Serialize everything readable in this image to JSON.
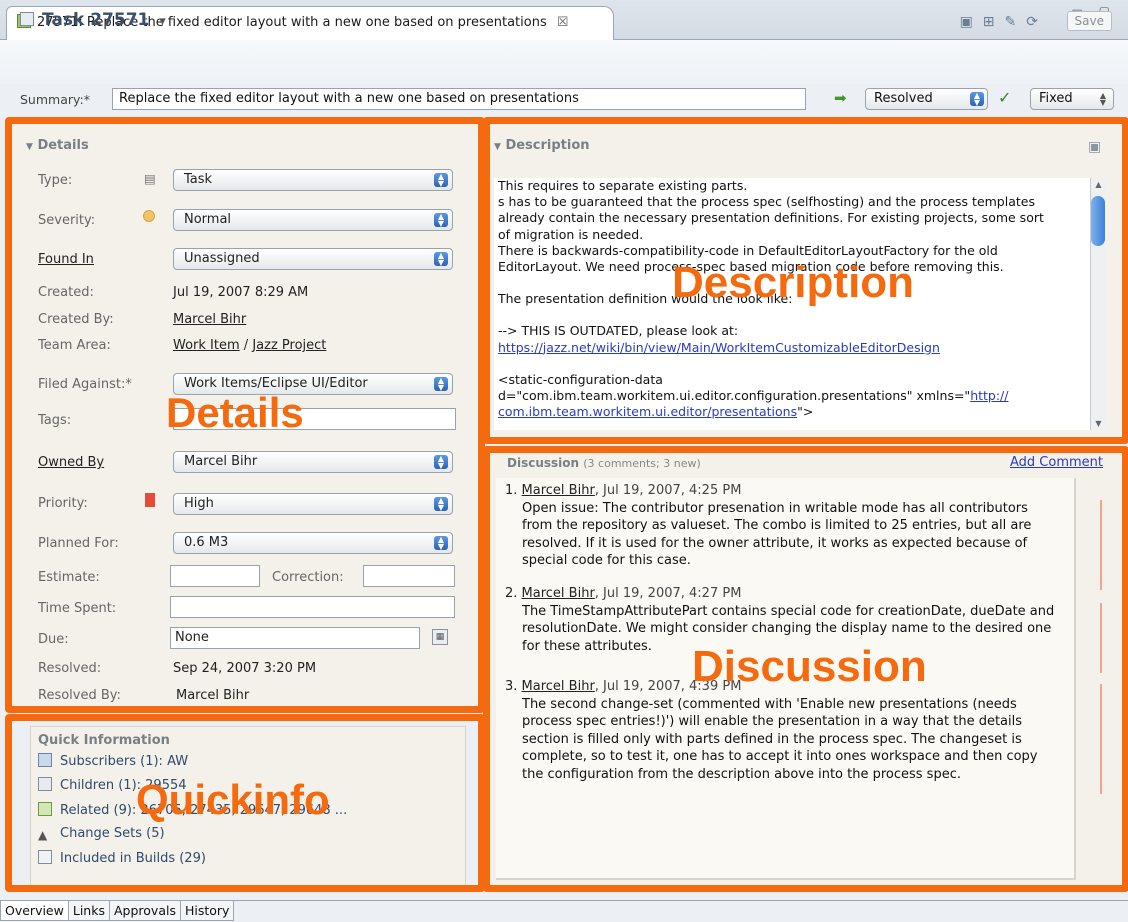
{
  "editor_tab": {
    "title": "27571: Replace the fixed editor layout with a new one based on presentations",
    "close": "☒"
  },
  "window_controls": "▭ ▢",
  "header": {
    "title": "Task 27571",
    "dropdown": "▾",
    "save_label": "Save"
  },
  "summary": {
    "label": "Summary:*",
    "value": "Replace the fixed editor layout with a new one based on presentations",
    "state": "Resolved",
    "resolution": "Fixed"
  },
  "details": {
    "header": "Details",
    "fields": {
      "type": {
        "label": "Type:",
        "value": "Task"
      },
      "severity": {
        "label": "Severity:",
        "value": "Normal"
      },
      "found_in": {
        "label": "Found In",
        "value": "Unassigned"
      },
      "created": {
        "label": "Created:",
        "value": "Jul 19, 2007 8:29 AM"
      },
      "created_by": {
        "label": "Created By:",
        "value": "Marcel Bihr"
      },
      "team_area": {
        "label": "Team Area:",
        "value_a": "Work Item",
        "sep": "/",
        "value_b": "Jazz Project"
      },
      "filed_against": {
        "label": "Filed Against:*",
        "value": "Work Items/Eclipse UI/Editor"
      },
      "tags": {
        "label": "Tags:",
        "value": ""
      },
      "owned_by": {
        "label": "Owned By",
        "value": "Marcel Bihr"
      },
      "priority": {
        "label": "Priority:",
        "value": "High"
      },
      "planned_for": {
        "label": "Planned For:",
        "value": "0.6 M3"
      },
      "estimate": {
        "label": "Estimate:",
        "value": ""
      },
      "correction": {
        "label": "Correction:",
        "value": ""
      },
      "time_spent": {
        "label": "Time Spent:",
        "value": ""
      },
      "due": {
        "label": "Due:",
        "value": "None"
      },
      "resolved": {
        "label": "Resolved:",
        "value": "Sep 24, 2007 3:20 PM"
      },
      "resolved_by": {
        "label": "Resolved By:",
        "value": "Marcel Bihr"
      }
    }
  },
  "description": {
    "header": "Description",
    "lines": [
      "This requires to separate existing parts.",
      "s has to be guaranteed that the process spec (selfhosting) and the process templates",
      "already contain the necessary presentation definitions. For existing projects, some sort",
      "of migration is needed.",
      "There is backwards-compatibility-code in DefaultEditorLayoutFactory for the old",
      "EditorLayout. We need process-spec based migration code before removing this.",
      "",
      "The presentation definition would the look like:",
      "",
      "--> THIS IS OUTDATED, please look at:"
    ],
    "link1": "https://jazz.net/wiki/bin/view/Main/WorkItemCustomizableEditorDesign",
    "line_cfg1": "<static-configuration-data",
    "line_cfg2_a": "d=\"com.ibm.team.workitem.ui.editor.configuration.presentations\" xmlns=\"",
    "line_cfg2_link": "http://",
    "line_cfg3_link": "com.ibm.team.workitem.ui.editor/presentations",
    "line_cfg3_end": "\">"
  },
  "discussion": {
    "header": "Discussion",
    "meta": "(3 comments; 3 new)",
    "add_comment": "Add Comment",
    "comments": [
      {
        "num": "1.",
        "author": "Marcel Bihr",
        "date": ", Jul 19, 2007, 4:25 PM",
        "lines": [
          "Open issue: The contributor presenation in writable mode has all contributors",
          "from the repository as valueset. The combo is limited to 25 entries, but all are",
          "resolved. If it is used for the owner attribute, it works as expected because of",
          "special code for this case."
        ]
      },
      {
        "num": "2.",
        "author": "Marcel Bihr",
        "date": ", Jul 19, 2007, 4:27 PM",
        "lines": [
          "The TimeStampAttributePart contains special code for creationDate, dueDate and",
          "resolutionDate. We might consider changing the display name to the desired one",
          "for these attributes."
        ]
      },
      {
        "num": "3.",
        "author": "Marcel Bihr",
        "date": ", Jul 19, 2007, 4:39 PM",
        "lines": [
          "The second change-set (commented with 'Enable new presentations (needs",
          "process spec entries!)') will enable the presentation in a way that the details",
          "section is filled only with parts defined in the process spec. The changeset is",
          "complete, so to test it, one has to accept it into ones workspace and then copy",
          "the configuration from the description above into the process spec."
        ]
      }
    ]
  },
  "quick_info": {
    "header": "Quick Information",
    "subscribers": "Subscribers (1):",
    "subscribers_value": "AW",
    "children": "Children (1):",
    "children_value": "29554",
    "related": "Related (9):",
    "related_value": "26705, 27435, 29647, 29648 ...",
    "change_sets": "Change Sets (5)",
    "builds": "Included in Builds (29)"
  },
  "overlay_labels": {
    "details": "Details",
    "description": "Description",
    "discussion": "Discussion",
    "quickinfo": "Quickinfo"
  },
  "bottom_tabs": [
    "Overview",
    "Links",
    "Approvals",
    "History"
  ],
  "colors": {
    "highlight": "#f56a0e",
    "link": "#2a3ac0",
    "combo_accent": "#3c7fd4"
  }
}
